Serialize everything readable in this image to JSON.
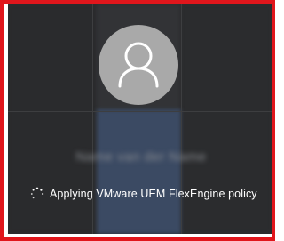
{
  "login": {
    "username": "Name van der Name",
    "status_text": "Applying VMware UEM FlexEngine policy"
  },
  "icons": {
    "avatar": "user-icon",
    "spinner": "loading-spinner-icon"
  },
  "colors": {
    "border": "#e0161c",
    "background": "#2c2d2f",
    "avatar_bg": "#a9a9a9",
    "avatar_fg": "#ffffff",
    "status_text": "#ffffff"
  }
}
